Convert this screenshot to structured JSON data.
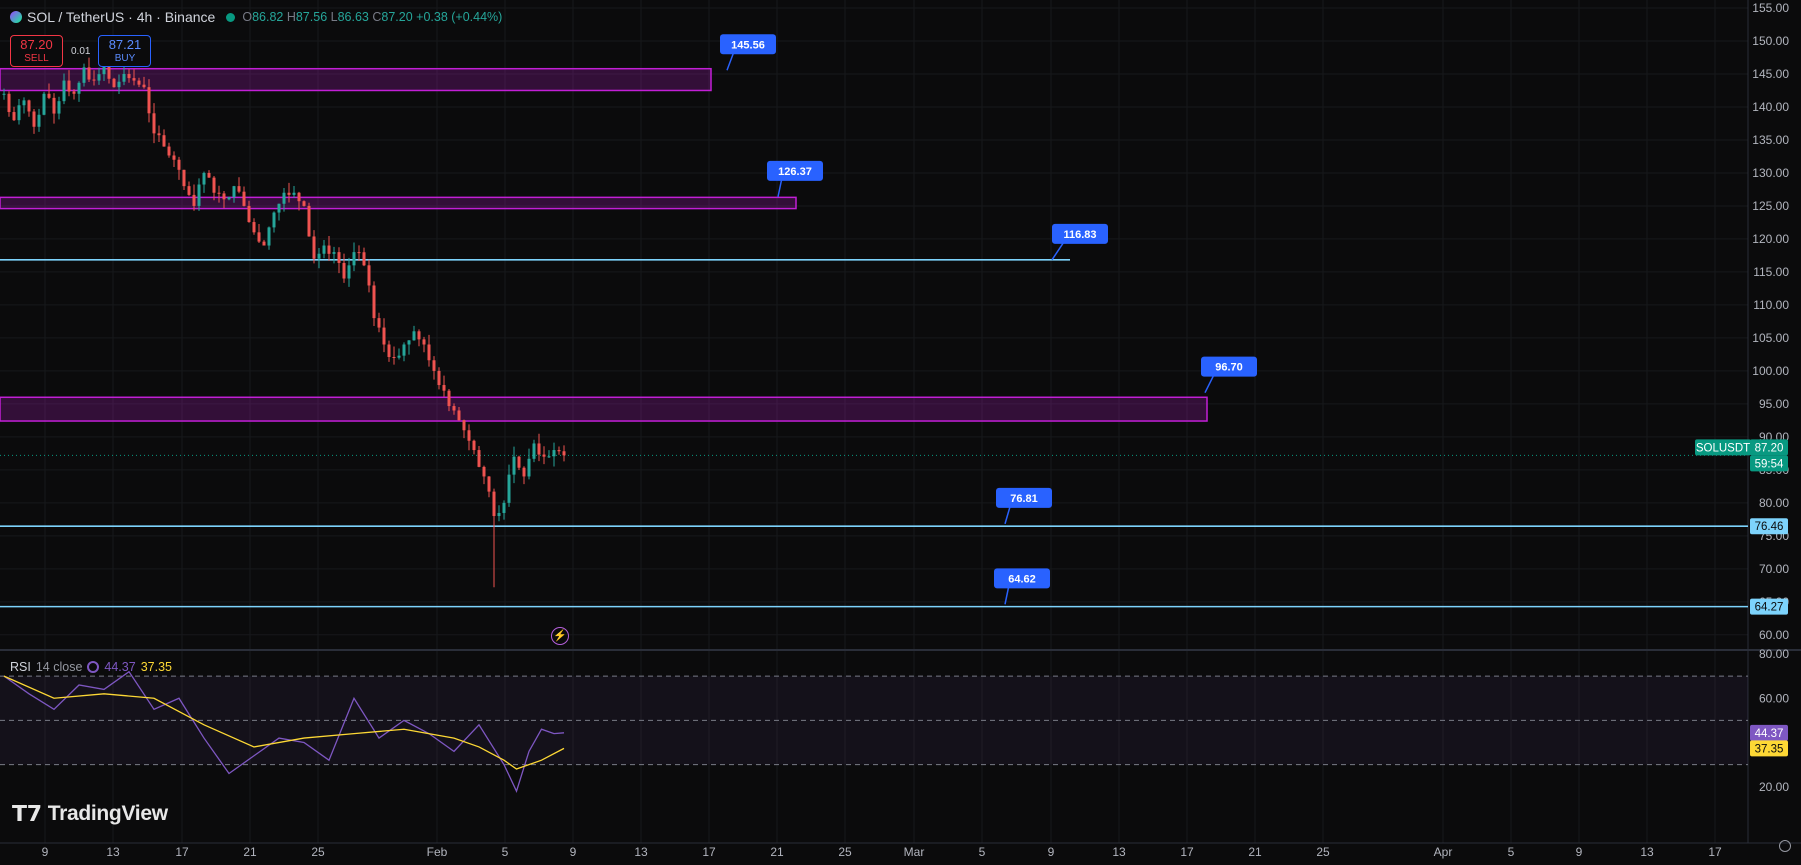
{
  "header": {
    "symbol": "SOL / TetherUS · 4h · Binance",
    "open_label": "O",
    "open": "86.82",
    "high_label": "H",
    "high": "87.56",
    "low_label": "L",
    "low": "86.63",
    "close_label": "C",
    "close": "87.20",
    "change": "+0.38 (+0.44%)"
  },
  "trade": {
    "sell_price": "87.20",
    "sell_label": "SELL",
    "spread": "0.01",
    "buy_price": "87.21",
    "buy_label": "BUY"
  },
  "rsi": {
    "label": "RSI",
    "params": "14 close",
    "value": "44.37",
    "ma_value": "37.35"
  },
  "brand": {
    "name": "TradingView"
  },
  "colors": {
    "up": "#26a69a",
    "down": "#ef5350",
    "zone": "#c21fd6",
    "level": "#7dd3fc",
    "callout": "#2962ff",
    "rsi": "#7e57c2",
    "rsi_ma": "#fdd835"
  },
  "chart_data": {
    "type": "candlestick",
    "y_axis_labels": [
      "155.00",
      "150.00",
      "145.00",
      "140.00",
      "135.00",
      "130.00",
      "125.00",
      "120.00",
      "115.00",
      "110.00",
      "105.00",
      "100.00",
      "95.00",
      "90.00",
      "85.00",
      "80.00",
      "75.00",
      "70.00",
      "65.00",
      "60.00"
    ],
    "ylim": [
      58,
      155
    ],
    "x_axis_labels": [
      "9",
      "13",
      "17",
      "21",
      "25",
      "Feb",
      "5",
      "9",
      "13",
      "17",
      "21",
      "25",
      "Mar",
      "5",
      "9",
      "13",
      "17",
      "21",
      "25",
      "Apr",
      "5",
      "9",
      "13",
      "17"
    ],
    "zones": [
      {
        "low": 142.5,
        "high": 145.8
      },
      {
        "low": 124.6,
        "high": 126.3
      },
      {
        "low": 92.4,
        "high": 96.0
      }
    ],
    "levels": [
      116.83,
      76.46,
      64.27
    ],
    "callouts": [
      {
        "label": "145.56",
        "value": 145.56
      },
      {
        "label": "126.37",
        "value": 126.37
      },
      {
        "label": "116.83",
        "value": 116.83
      },
      {
        "label": "96.70",
        "value": 96.7
      },
      {
        "label": "76.81",
        "value": 76.81
      },
      {
        "label": "64.62",
        "value": 64.62
      }
    ],
    "price_tags": [
      {
        "label": "SOLUSDT",
        "value": 87.2
      },
      {
        "label": "87.20",
        "value": 87.2
      },
      {
        "label": "59:54",
        "value": 87.2
      },
      {
        "label": "76.46",
        "value": 76.46
      },
      {
        "label": "64.27",
        "value": 64.27
      }
    ],
    "price_path": [
      [
        0,
        142
      ],
      [
        4,
        138
      ],
      [
        8,
        141
      ],
      [
        12,
        137
      ],
      [
        16,
        142
      ],
      [
        20,
        139
      ],
      [
        24,
        144
      ],
      [
        28,
        142
      ],
      [
        32,
        146
      ],
      [
        36,
        144
      ],
      [
        40,
        147
      ],
      [
        44,
        143
      ],
      [
        48,
        145
      ],
      [
        52,
        144
      ],
      [
        56,
        143
      ],
      [
        60,
        136
      ],
      [
        64,
        134
      ],
      [
        68,
        132
      ],
      [
        72,
        128
      ],
      [
        76,
        125
      ],
      [
        80,
        130
      ],
      [
        84,
        127
      ],
      [
        88,
        126
      ],
      [
        92,
        128
      ],
      [
        96,
        125
      ],
      [
        100,
        121
      ],
      [
        104,
        119
      ],
      [
        108,
        124
      ],
      [
        112,
        127
      ],
      [
        116,
        127
      ],
      [
        120,
        125
      ],
      [
        124,
        117
      ],
      [
        128,
        119
      ],
      [
        132,
        118
      ],
      [
        136,
        114
      ],
      [
        140,
        118
      ],
      [
        144,
        116
      ],
      [
        148,
        108
      ],
      [
        152,
        104
      ],
      [
        156,
        102
      ],
      [
        160,
        104
      ],
      [
        164,
        106
      ],
      [
        168,
        104
      ],
      [
        172,
        100
      ],
      [
        176,
        97
      ],
      [
        180,
        94
      ],
      [
        184,
        91
      ],
      [
        188,
        88
      ],
      [
        192,
        84
      ],
      [
        196,
        78
      ],
      [
        200,
        80
      ],
      [
        204,
        87
      ],
      [
        208,
        84
      ],
      [
        212,
        89
      ],
      [
        216,
        87
      ],
      [
        220,
        88
      ],
      [
        224,
        87.2
      ]
    ],
    "rsi": {
      "ylim": [
        0,
        80
      ],
      "y_axis_labels": [
        "80.00",
        "60.00",
        "20.00"
      ],
      "band": [
        30,
        70
      ],
      "mid": 50,
      "rsi_path": [
        [
          0,
          70
        ],
        [
          10,
          62
        ],
        [
          20,
          55
        ],
        [
          30,
          66
        ],
        [
          40,
          64
        ],
        [
          50,
          72
        ],
        [
          60,
          55
        ],
        [
          70,
          60
        ],
        [
          80,
          42
        ],
        [
          90,
          26
        ],
        [
          100,
          34
        ],
        [
          110,
          42
        ],
        [
          120,
          40
        ],
        [
          130,
          32
        ],
        [
          140,
          60
        ],
        [
          150,
          42
        ],
        [
          160,
          50
        ],
        [
          170,
          44
        ],
        [
          180,
          36
        ],
        [
          190,
          48
        ],
        [
          200,
          30
        ],
        [
          205,
          18
        ],
        [
          210,
          36
        ],
        [
          215,
          46
        ],
        [
          220,
          44
        ],
        [
          224,
          44.37
        ]
      ],
      "ma_path": [
        [
          0,
          70
        ],
        [
          20,
          60
        ],
        [
          40,
          62
        ],
        [
          60,
          60
        ],
        [
          80,
          48
        ],
        [
          100,
          38
        ],
        [
          120,
          42
        ],
        [
          140,
          44
        ],
        [
          160,
          46
        ],
        [
          180,
          42
        ],
        [
          190,
          38
        ],
        [
          200,
          32
        ],
        [
          205,
          28
        ],
        [
          215,
          32
        ],
        [
          224,
          37.35
        ]
      ]
    }
  }
}
